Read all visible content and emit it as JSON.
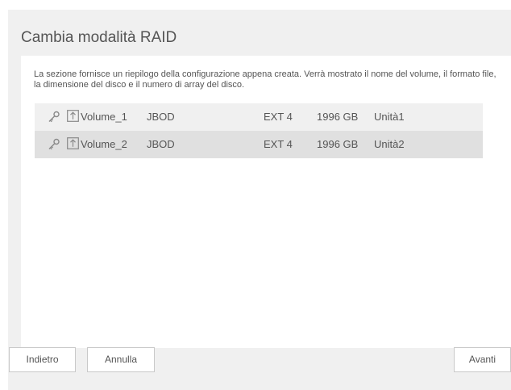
{
  "dialog": {
    "title": "Cambia modalità RAID",
    "description": "La sezione fornisce un riepilogo della configurazione appena creata. Verrà mostrato il nome del volume, il formato file, la dimensione del disco e il numero di array del disco."
  },
  "volumes": [
    {
      "name": "Volume_1",
      "raid": "JBOD",
      "filesystem": "EXT 4",
      "size": "1996 GB",
      "unit": "Unità1",
      "icons": [
        "key-icon",
        "upload-icon"
      ]
    },
    {
      "name": "Volume_2",
      "raid": "JBOD",
      "filesystem": "EXT 4",
      "size": "1996 GB",
      "unit": "Unità2",
      "icons": [
        "key-icon",
        "upload-icon"
      ]
    }
  ],
  "buttons": {
    "back": "Indietro",
    "cancel": "Annulla",
    "next": "Avanti"
  },
  "colors": {
    "dialog_bg": "#f0f0f0",
    "panel_bg": "#ffffff",
    "row_odd": "#f0f0f0",
    "row_even": "#e0e0e0",
    "text": "#555555",
    "icon": "#8a8a8a"
  }
}
